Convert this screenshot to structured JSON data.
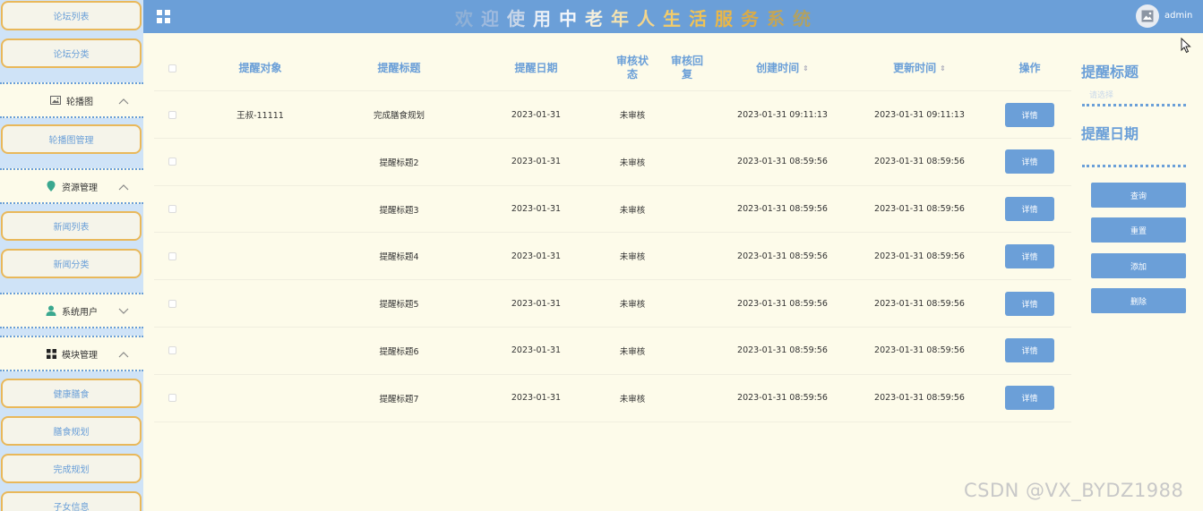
{
  "sidebar": {
    "forum_list": "论坛列表",
    "forum_category": "论坛分类",
    "carousel_group": "轮播图",
    "carousel_manage": "轮播图管理",
    "resource_group": "资源管理",
    "news_list": "新闻列表",
    "news_category": "新闻分类",
    "system_user_group": "系统用户",
    "module_group": "模块管理",
    "healthy_diet": "健康膳食",
    "diet_plan": "膳食规划",
    "complete_plan": "完成规划",
    "children_info": "子女信息"
  },
  "header": {
    "title_chars": [
      "欢",
      "迎",
      "使",
      "用",
      "中",
      "老",
      "年",
      "人",
      "生",
      "活",
      "服",
      "务",
      "系",
      "统"
    ],
    "title_colors": [
      "#8fb0d6",
      "#9fbade",
      "#c8d6e8",
      "#e8eef6",
      "#f3f6fa",
      "#f6f0dc",
      "#f5e3b0",
      "#f3d58c",
      "#f3cc6a",
      "#f0c355",
      "#ebb747",
      "#d8ab4a",
      "#c4a556",
      "#b1a163"
    ],
    "user": "admin"
  },
  "table": {
    "headers": {
      "target": "提醒对象",
      "title": "提醒标题",
      "date": "提醒日期",
      "status_line1": "审核状",
      "status_line2": "态",
      "reply_line1": "审核回",
      "reply_line2": "复",
      "created": "创建时间",
      "updated": "更新时间",
      "action": "操作"
    },
    "detail_label": "详情",
    "rows": [
      {
        "target": "王叔-11111",
        "title": "完成膳食规划",
        "date": "2023-01-31",
        "status": "未审核",
        "reply": "",
        "created": "2023-01-31 09:11:13",
        "updated": "2023-01-31 09:11:13"
      },
      {
        "target": "",
        "title": "提醒标题2",
        "date": "2023-01-31",
        "status": "未审核",
        "reply": "",
        "created": "2023-01-31 08:59:56",
        "updated": "2023-01-31 08:59:56"
      },
      {
        "target": "",
        "title": "提醒标题3",
        "date": "2023-01-31",
        "status": "未审核",
        "reply": "",
        "created": "2023-01-31 08:59:56",
        "updated": "2023-01-31 08:59:56"
      },
      {
        "target": "",
        "title": "提醒标题4",
        "date": "2023-01-31",
        "status": "未审核",
        "reply": "",
        "created": "2023-01-31 08:59:56",
        "updated": "2023-01-31 08:59:56"
      },
      {
        "target": "",
        "title": "提醒标题5",
        "date": "2023-01-31",
        "status": "未审核",
        "reply": "",
        "created": "2023-01-31 08:59:56",
        "updated": "2023-01-31 08:59:56"
      },
      {
        "target": "",
        "title": "提醒标题6",
        "date": "2023-01-31",
        "status": "未审核",
        "reply": "",
        "created": "2023-01-31 08:59:56",
        "updated": "2023-01-31 08:59:56"
      },
      {
        "target": "",
        "title": "提醒标题7",
        "date": "2023-01-31",
        "status": "未审核",
        "reply": "",
        "created": "2023-01-31 08:59:56",
        "updated": "2023-01-31 08:59:56"
      }
    ]
  },
  "search_panel": {
    "title_label": "提醒标题",
    "title_placeholder": "请选择",
    "date_label": "提醒日期",
    "query": "查询",
    "reset": "重置",
    "add": "添加",
    "delete": "删除"
  },
  "watermark": "CSDN @VX_BYDZ1988",
  "colors": {
    "accent": "#6b9fd8",
    "sidebar_border": "#e9b85a",
    "background": "#fdfbea"
  }
}
